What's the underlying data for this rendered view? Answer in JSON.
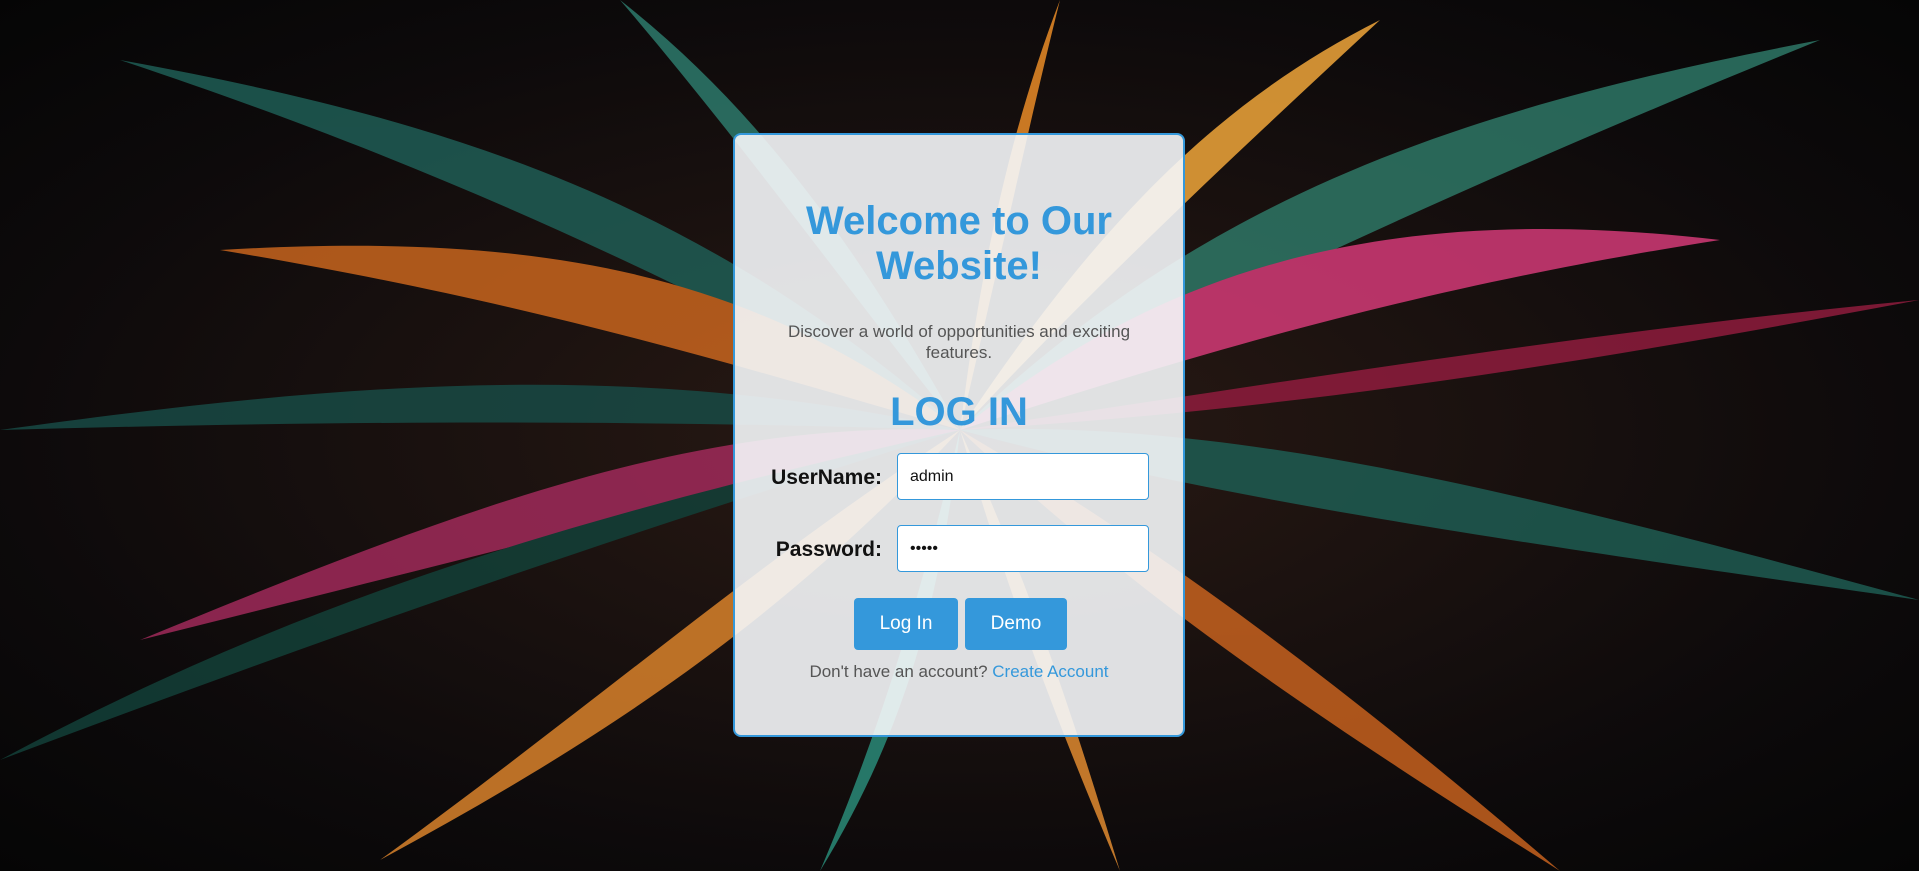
{
  "welcome": {
    "title": "Welcome to Our Website!",
    "subtitle": "Discover a world of opportunities and exciting features."
  },
  "login": {
    "heading": "LOG IN",
    "username_label": "UserName:",
    "username_value": "admin",
    "password_label": "Password:",
    "password_value": "admin",
    "login_button": "Log In",
    "demo_button": "Demo",
    "signup_prompt": "Don't have an account?",
    "signup_link": "Create Account"
  },
  "colors": {
    "accent": "#3498db",
    "card_background": "#f5f7fa",
    "text_muted": "#555555"
  }
}
